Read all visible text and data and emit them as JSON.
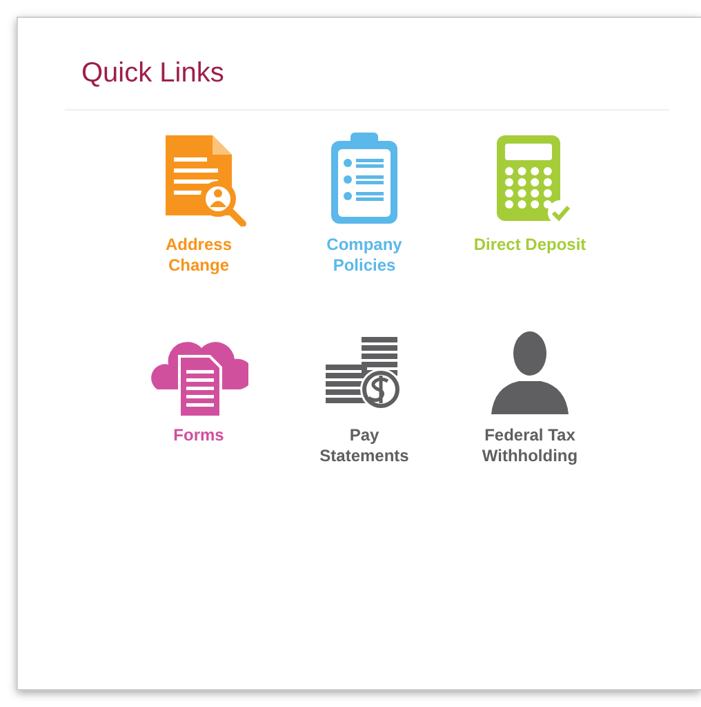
{
  "title": "Quick Links",
  "links": [
    {
      "label": "Address\nChange",
      "kind": "document-search",
      "color": "#f7941d"
    },
    {
      "label": "Company\nPolicies",
      "kind": "clipboard",
      "color": "#5bb8ea"
    },
    {
      "label": "Direct Deposit",
      "kind": "calculator",
      "color": "#a5cd39"
    },
    {
      "label": "Forms",
      "kind": "cloud-document",
      "color": "#d1509e"
    },
    {
      "label": "Pay\nStatements",
      "kind": "coins",
      "color": "#5f5f61"
    },
    {
      "label": "Federal Tax\nWithholding",
      "kind": "person",
      "color": "#5f5f61"
    }
  ]
}
